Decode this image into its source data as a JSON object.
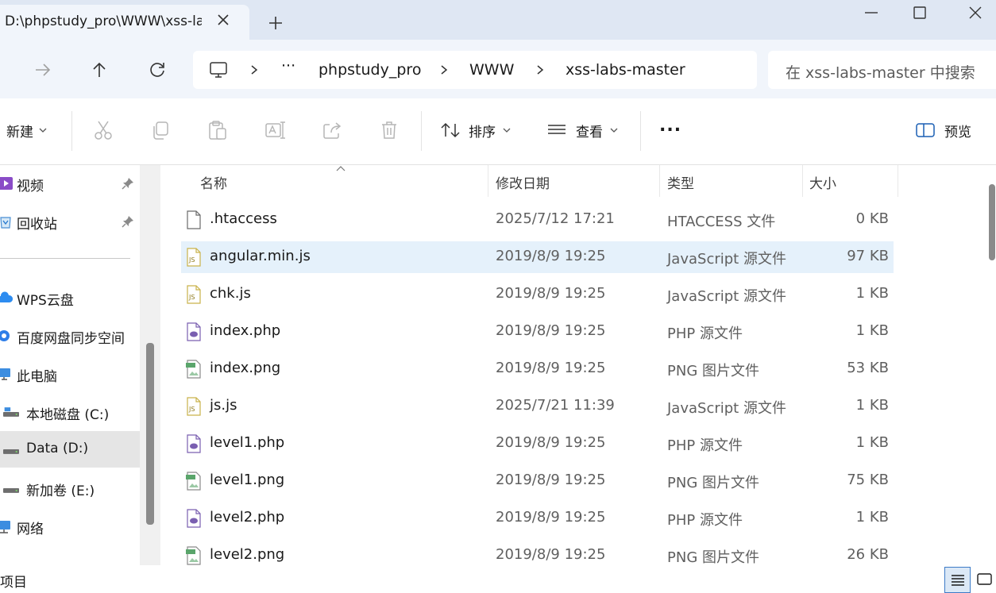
{
  "tab": {
    "title": "D:\\phpstudy_pro\\WWW\\xss-la"
  },
  "address": {
    "more": "···",
    "crumbs": [
      "phpstudy_pro",
      "WWW",
      "xss-labs-master"
    ]
  },
  "search": {
    "placeholder": "在 xss-labs-master 中搜索"
  },
  "toolbar": {
    "new_label": "新建",
    "sort_label": "排序",
    "view_label": "查看",
    "more_label": "...",
    "preview_label": "预览"
  },
  "sidebar": {
    "items": [
      {
        "label": "视频",
        "icon": "video-folder-icon",
        "pinned": true
      },
      {
        "label": "回收站",
        "icon": "recycle-bin-icon",
        "pinned": true
      },
      {
        "label": "WPS云盘",
        "icon": "cloud-icon"
      },
      {
        "label": "百度网盘同步空间",
        "icon": "baidu-netdisk-icon"
      },
      {
        "label": "此电脑",
        "icon": "computer-icon"
      },
      {
        "label": "本地磁盘 (C:)",
        "icon": "drive-icon"
      },
      {
        "label": "Data (D:)",
        "icon": "drive-icon",
        "selected": true
      },
      {
        "label": "新加卷 (E:)",
        "icon": "drive-icon"
      },
      {
        "label": "网络",
        "icon": "network-icon"
      }
    ]
  },
  "columns": {
    "name": "名称",
    "date": "修改日期",
    "type": "类型",
    "size": "大小"
  },
  "files": [
    {
      "name": ".htaccess",
      "date": "2025/7/12 17:21",
      "type": "HTACCESS 文件",
      "size": "0 KB",
      "kind": "generic"
    },
    {
      "name": "angular.min.js",
      "date": "2019/8/9 19:25",
      "type": "JavaScript 源文件",
      "size": "97 KB",
      "kind": "js",
      "selected": true
    },
    {
      "name": "chk.js",
      "date": "2019/8/9 19:25",
      "type": "JavaScript 源文件",
      "size": "1 KB",
      "kind": "js"
    },
    {
      "name": "index.php",
      "date": "2019/8/9 19:25",
      "type": "PHP 源文件",
      "size": "1 KB",
      "kind": "php"
    },
    {
      "name": "index.png",
      "date": "2019/8/9 19:25",
      "type": "PNG 图片文件",
      "size": "53 KB",
      "kind": "png"
    },
    {
      "name": "js.js",
      "date": "2025/7/21 11:39",
      "type": "JavaScript 源文件",
      "size": "1 KB",
      "kind": "js"
    },
    {
      "name": "level1.php",
      "date": "2019/8/9 19:25",
      "type": "PHP 源文件",
      "size": "1 KB",
      "kind": "php"
    },
    {
      "name": "level1.png",
      "date": "2019/8/9 19:25",
      "type": "PNG 图片文件",
      "size": "75 KB",
      "kind": "png"
    },
    {
      "name": "level2.php",
      "date": "2019/8/9 19:25",
      "type": "PHP 源文件",
      "size": "1 KB",
      "kind": "php"
    },
    {
      "name": "level2.png",
      "date": "2019/8/9 19:25",
      "type": "PNG 图片文件",
      "size": "26 KB",
      "kind": "png"
    }
  ],
  "status": {
    "text": "项目"
  },
  "colors": {
    "selection": "#e5f1fb",
    "accent": "#3d7bc7",
    "php": "#7a5fb0",
    "js": "#c9b24a",
    "png": "#5aa56b"
  }
}
